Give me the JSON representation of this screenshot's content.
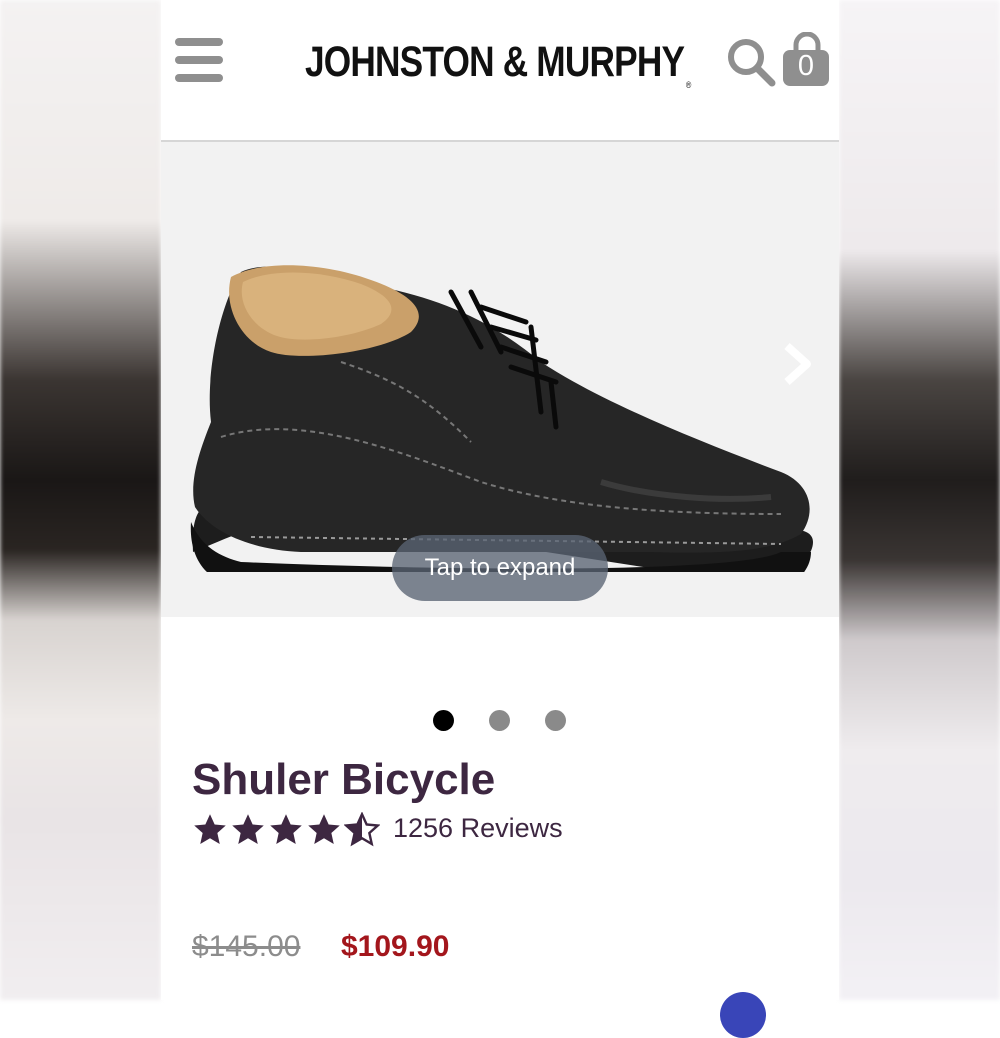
{
  "brand": {
    "name": "JOHNSTON & MURPHY",
    "registered_mark": "®"
  },
  "header": {
    "cart_count": "0"
  },
  "gallery": {
    "tap_hint": "Tap to expand",
    "slide_count": 3,
    "active_slide": 1
  },
  "product": {
    "name": "Shuler Bicycle",
    "rating": 4.5,
    "rating_max": 5,
    "reviews_label": "1256 Reviews",
    "original_price": "$145.00",
    "sale_price": "$109.90"
  },
  "colors": {
    "title": "#3d2741",
    "sale_price": "#a3161c",
    "original_price": "#8c8c8c",
    "icon_gray": "#8f8f8f"
  },
  "icons": [
    "hamburger-menu-icon",
    "search-icon",
    "shopping-bag-icon",
    "chevron-right-icon",
    "star-icon",
    "half-star-icon"
  ]
}
